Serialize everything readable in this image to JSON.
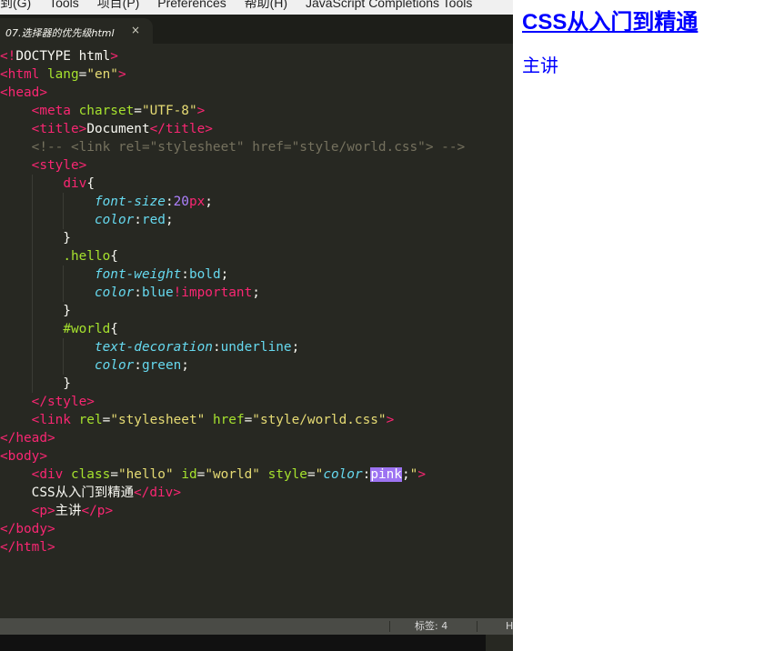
{
  "menubar": {
    "items": [
      "到(G)",
      "Tools",
      "项目(P)",
      "Preferences",
      "帮助(H)",
      "JavaScript Completions Tools"
    ]
  },
  "tab": {
    "label": "07.选择器的优先级html",
    "close": "×"
  },
  "code_lines": [
    [
      [
        "t",
        "<!"
      ],
      [
        "w",
        "DOCTYPE html"
      ],
      [
        "t",
        ">"
      ]
    ],
    [
      [
        "t",
        "<html "
      ],
      [
        "a",
        "lang"
      ],
      [
        "w",
        "="
      ],
      [
        "s",
        "\"en\""
      ],
      [
        "t",
        ">"
      ]
    ],
    [
      [
        "t",
        "<head>"
      ]
    ],
    [
      [
        "w",
        "    "
      ],
      [
        "t",
        "<meta "
      ],
      [
        "a",
        "charset"
      ],
      [
        "w",
        "="
      ],
      [
        "s",
        "\"UTF-8\""
      ],
      [
        "t",
        ">"
      ]
    ],
    [
      [
        "w",
        "    "
      ],
      [
        "t",
        "<title>"
      ],
      [
        "w",
        "Document"
      ],
      [
        "t",
        "</title>"
      ]
    ],
    [
      [
        "w",
        "    "
      ],
      [
        "c",
        "<!-- <link rel=\"stylesheet\" href=\"style/world.css\"> -->"
      ]
    ],
    [
      [
        "w",
        "    "
      ],
      [
        "t",
        "<style>"
      ]
    ],
    [
      [
        "w",
        "        "
      ],
      [
        "t",
        "div"
      ],
      [
        "w",
        "{"
      ]
    ],
    [
      [
        "w",
        "            "
      ],
      [
        "p",
        "font-size"
      ],
      [
        "w",
        ":"
      ],
      [
        "n",
        "20"
      ],
      [
        "t",
        "px"
      ],
      [
        "w",
        ";"
      ]
    ],
    [
      [
        "w",
        "            "
      ],
      [
        "p",
        "color"
      ],
      [
        "w",
        ":"
      ],
      [
        "v",
        "red"
      ],
      [
        "w",
        ";"
      ]
    ],
    [
      [
        "w",
        "        }"
      ]
    ],
    [
      [
        "w",
        "        "
      ],
      [
        "a",
        ".hello"
      ],
      [
        "w",
        "{"
      ]
    ],
    [
      [
        "w",
        "            "
      ],
      [
        "p",
        "font-weight"
      ],
      [
        "w",
        ":"
      ],
      [
        "v",
        "bold"
      ],
      [
        "w",
        ";"
      ]
    ],
    [
      [
        "w",
        "            "
      ],
      [
        "p",
        "color"
      ],
      [
        "w",
        ":"
      ],
      [
        "v",
        "blue"
      ],
      [
        "t",
        "!important"
      ],
      [
        "w",
        ";"
      ]
    ],
    [
      [
        "w",
        "        }"
      ]
    ],
    [
      [
        "w",
        "        "
      ],
      [
        "a",
        "#world"
      ],
      [
        "w",
        "{"
      ]
    ],
    [
      [
        "w",
        "            "
      ],
      [
        "p",
        "text-decoration"
      ],
      [
        "w",
        ":"
      ],
      [
        "v",
        "underline"
      ],
      [
        "w",
        ";"
      ]
    ],
    [
      [
        "w",
        "            "
      ],
      [
        "p",
        "color"
      ],
      [
        "w",
        ":"
      ],
      [
        "v",
        "green"
      ],
      [
        "w",
        ";"
      ]
    ],
    [
      [
        "w",
        "        }"
      ]
    ],
    [
      [
        "w",
        "    "
      ],
      [
        "t",
        "</style>"
      ]
    ],
    [
      [
        "w",
        "    "
      ],
      [
        "t",
        "<link "
      ],
      [
        "a",
        "rel"
      ],
      [
        "w",
        "="
      ],
      [
        "s",
        "\"stylesheet\""
      ],
      [
        "w",
        " "
      ],
      [
        "a",
        "href"
      ],
      [
        "w",
        "="
      ],
      [
        "s",
        "\"style/world.css\""
      ],
      [
        "t",
        ">"
      ]
    ],
    [
      [
        "t",
        "</head>"
      ]
    ],
    [
      [
        "t",
        "<body>"
      ]
    ],
    [
      [
        "w",
        "    "
      ],
      [
        "t",
        "<div "
      ],
      [
        "a",
        "class"
      ],
      [
        "w",
        "="
      ],
      [
        "s",
        "\"hello\""
      ],
      [
        "w",
        " "
      ],
      [
        "a",
        "id"
      ],
      [
        "w",
        "="
      ],
      [
        "s",
        "\"world\""
      ],
      [
        "w",
        " "
      ],
      [
        "a",
        "style"
      ],
      [
        "w",
        "="
      ],
      [
        "s",
        "\""
      ],
      [
        "p",
        "color"
      ],
      [
        "w",
        ":"
      ],
      [
        "sel",
        "pink"
      ],
      [
        "w",
        ";"
      ],
      [
        "s",
        "\""
      ],
      [
        "t",
        ">"
      ]
    ],
    [
      [
        "w",
        "    CSS从入门到精通"
      ],
      [
        "t",
        "</div>"
      ]
    ],
    [
      [
        "w",
        "    "
      ],
      [
        "t",
        "<p>"
      ],
      [
        "w",
        "主讲"
      ],
      [
        "t",
        "</p>"
      ]
    ],
    [
      [
        "t",
        "</body>"
      ]
    ],
    [
      [
        "t",
        "</html>"
      ]
    ]
  ],
  "status": {
    "tab_size": "标签: 4",
    "syntax": "H"
  },
  "preview": {
    "title": "CSS从入门到精通",
    "para": "主讲"
  }
}
